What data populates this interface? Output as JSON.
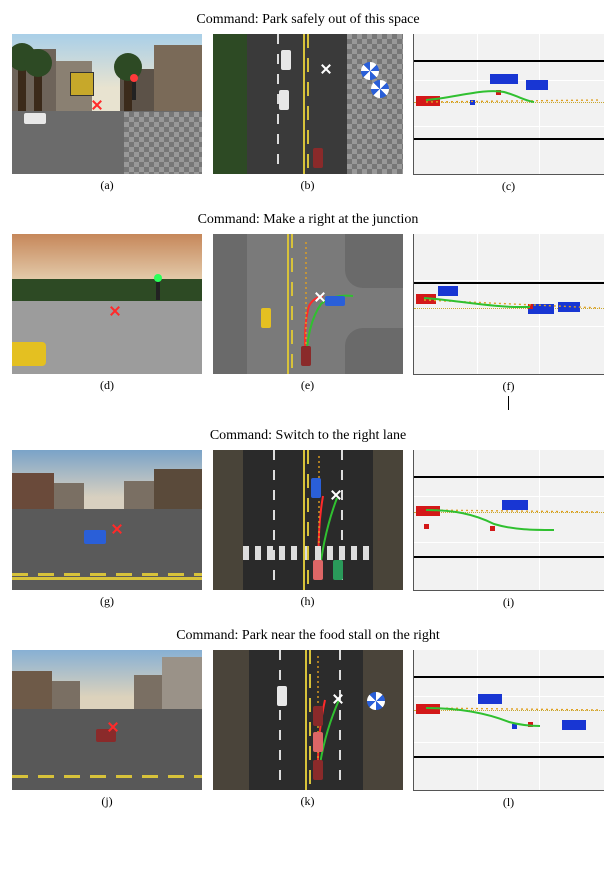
{
  "rows": [
    {
      "command": "Command: Park safely out of this space",
      "captions": [
        "(a)",
        "(b)",
        "(c)"
      ]
    },
    {
      "command": "Command: Make a right at the junction",
      "captions": [
        "(d)",
        "(e)",
        "(f)"
      ]
    },
    {
      "command": "Command: Switch to the right lane",
      "captions": [
        "(g)",
        "(h)",
        "(i)"
      ]
    },
    {
      "command": "Command: Park near the food stall on the right",
      "captions": [
        "(j)",
        "(k)",
        "(l)"
      ]
    }
  ],
  "chart_data": [
    {
      "type": "scatter",
      "title": "",
      "xlabel": "",
      "ylabel": "",
      "xlim": [
        0,
        10
      ],
      "ylim": [
        -3,
        3
      ],
      "axis_black_y": [
        -1.6,
        1.6
      ],
      "dotline_y": 0,
      "ego_red_box": {
        "x": [
          0.0,
          1.3
        ],
        "y": [
          -0.4,
          0.2
        ]
      },
      "blue_boxes": [
        {
          "x": [
            4.0,
            5.5
          ],
          "y": [
            1.0,
            1.5
          ]
        },
        {
          "x": [
            6.0,
            7.2
          ],
          "y": [
            0.7,
            1.2
          ]
        }
      ],
      "small_markers": [
        {
          "color": "red",
          "x": 4.3,
          "y": 0.5
        },
        {
          "color": "blue",
          "x": 3.0,
          "y": -0.1
        }
      ],
      "traj_green": [
        [
          0.6,
          -0.1
        ],
        [
          2.5,
          0.1
        ],
        [
          4.0,
          0.55
        ],
        [
          5.0,
          0.35
        ],
        [
          6.0,
          0.0
        ]
      ],
      "traj_orange": [
        [
          0.6,
          -0.1
        ],
        [
          3.0,
          -0.05
        ],
        [
          9.5,
          0.0
        ]
      ]
    },
    {
      "type": "scatter",
      "title": "",
      "xlabel": "",
      "ylabel": "",
      "xlim": [
        0,
        10
      ],
      "ylim": [
        -3,
        3
      ],
      "axis_black_y": [
        0.8
      ],
      "dotline_y": -0.25,
      "ego_red_box": {
        "x": [
          0.0,
          1.1
        ],
        "y": [
          -0.1,
          0.4
        ]
      },
      "blue_boxes": [
        {
          "x": [
            1.2,
            2.3
          ],
          "y": [
            0.3,
            0.8
          ]
        },
        {
          "x": [
            6.0,
            7.5
          ],
          "y": [
            -0.5,
            0.0
          ]
        },
        {
          "x": [
            7.6,
            8.8
          ],
          "y": [
            -0.4,
            0.1
          ]
        }
      ],
      "small_markers": [
        {
          "color": "red",
          "x": 6.0,
          "y": -0.2
        }
      ],
      "traj_green": [
        [
          0.6,
          0.15
        ],
        [
          3.0,
          -0.1
        ],
        [
          5.0,
          -0.2
        ],
        [
          6.0,
          -0.22
        ]
      ],
      "traj_orange": [
        [
          0.6,
          0.1
        ],
        [
          3.0,
          -0.2
        ],
        [
          9.5,
          -0.25
        ]
      ]
    },
    {
      "type": "scatter",
      "title": "",
      "xlabel": "",
      "ylabel": "",
      "xlim": [
        0,
        10
      ],
      "ylim": [
        -3,
        3
      ],
      "axis_black_y": [
        -1.6,
        1.6
      ],
      "dotline_y": 0.1,
      "ego_red_box": {
        "x": [
          0.0,
          1.3
        ],
        "y": [
          0.1,
          0.6
        ]
      },
      "blue_boxes": [
        {
          "x": [
            4.6,
            6.0
          ],
          "y": [
            0.4,
            0.9
          ]
        }
      ],
      "small_markers": [
        {
          "color": "red",
          "x": 0.5,
          "y": -0.3
        },
        {
          "color": "red",
          "x": 4.0,
          "y": -0.35
        }
      ],
      "traj_green": [
        [
          0.6,
          0.35
        ],
        [
          2.5,
          0.3
        ],
        [
          3.8,
          -0.1
        ],
        [
          5.5,
          -0.4
        ],
        [
          7.0,
          -0.4
        ]
      ],
      "traj_orange": [
        [
          0.6,
          0.3
        ],
        [
          3.0,
          0.15
        ],
        [
          9.5,
          0.1
        ]
      ]
    },
    {
      "type": "scatter",
      "title": "",
      "xlabel": "",
      "ylabel": "",
      "xlim": [
        0,
        10
      ],
      "ylim": [
        -3,
        3
      ],
      "axis_black_y": [
        -1.6,
        1.6
      ],
      "dotline_y": 0.15,
      "ego_red_box": {
        "x": [
          0.0,
          1.3
        ],
        "y": [
          0.1,
          0.6
        ]
      },
      "blue_boxes": [
        {
          "x": [
            3.4,
            4.7
          ],
          "y": [
            0.6,
            1.1
          ]
        },
        {
          "x": [
            7.8,
            9.1
          ],
          "y": [
            -0.5,
            0.0
          ]
        }
      ],
      "small_markers": [
        {
          "color": "red",
          "x": 6.0,
          "y": -0.25
        },
        {
          "color": "blue",
          "x": 5.2,
          "y": -0.3
        }
      ],
      "traj_green": [
        [
          0.6,
          0.35
        ],
        [
          2.5,
          0.3
        ],
        [
          4.0,
          0.1
        ],
        [
          5.5,
          -0.2
        ],
        [
          6.5,
          -0.3
        ]
      ],
      "traj_orange": [
        [
          0.6,
          0.3
        ],
        [
          3.0,
          0.18
        ],
        [
          9.5,
          0.15
        ]
      ]
    }
  ]
}
